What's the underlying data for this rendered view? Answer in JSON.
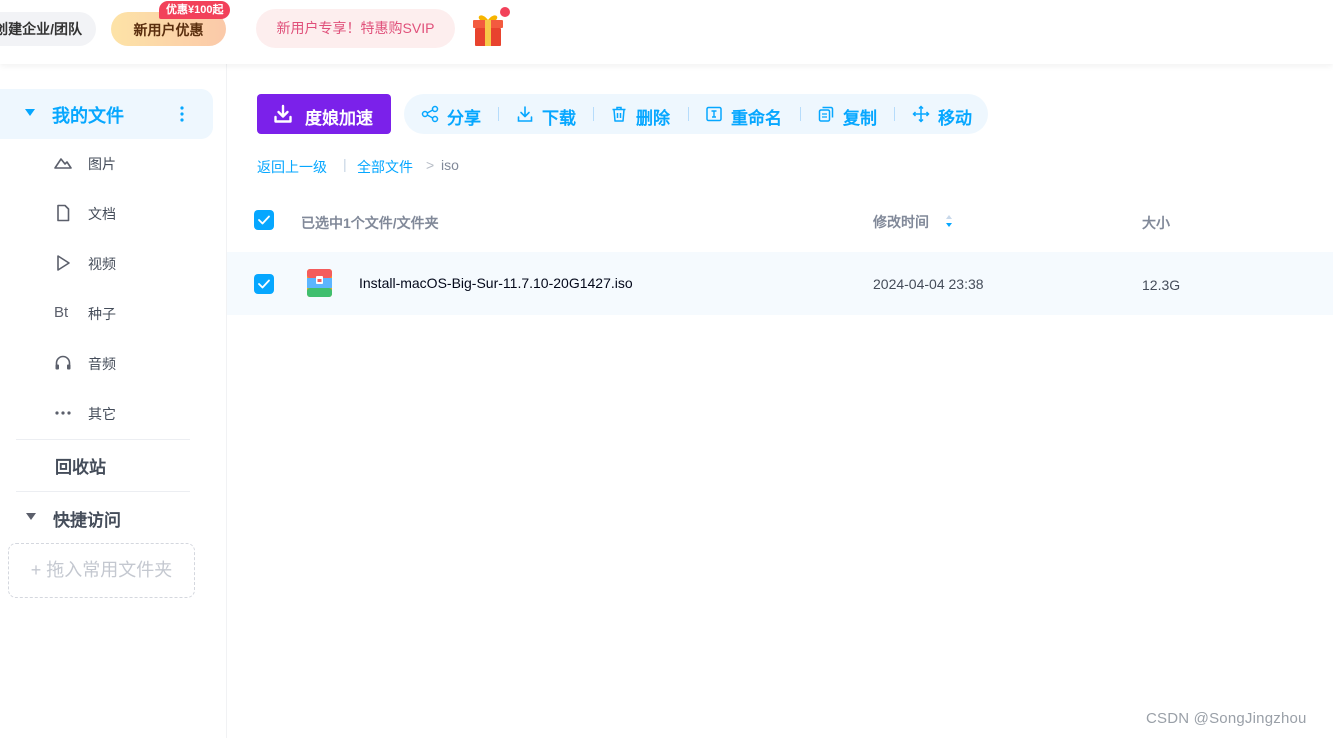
{
  "topbar": {
    "team_label": "创建企业/团队",
    "newuser_label": "新用户优惠",
    "newuser_badge": "优惠¥100起",
    "svip_promo": "新用户专享！特惠购SVIP",
    "gift_icon": "gift-icon"
  },
  "sidebar": {
    "my_files": "我的文件",
    "categories": [
      {
        "label": "图片",
        "icon": "image-icon"
      },
      {
        "label": "文档",
        "icon": "document-icon"
      },
      {
        "label": "视频",
        "icon": "video-icon"
      },
      {
        "label": "种子",
        "icon": "bt",
        "icon_text": "Bt"
      },
      {
        "label": "音频",
        "icon": "headphones-icon"
      },
      {
        "label": "其它",
        "icon": "more-icon"
      }
    ],
    "recycle": "回收站",
    "quick_access": "快捷访问",
    "dropzone": "+ 拖入常用文件夹"
  },
  "toolbar": {
    "speed": "度娘加速",
    "share": "分享",
    "download": "下载",
    "delete": "删除",
    "rename": "重命名",
    "copy": "复制",
    "move": "移动"
  },
  "breadcrumb": {
    "back": "返回上一级",
    "sep": "|",
    "all": "全部文件",
    "arrow": ">",
    "current": "iso"
  },
  "table": {
    "selection_summary": "已选中1个文件/文件夹",
    "col_modified": "修改时间",
    "col_size": "大小",
    "rows": [
      {
        "name": "Install-macOS-Big-Sur-11.7.10-20G1427.iso",
        "modified": "2024-04-04 23:38",
        "size": "12.3G",
        "checked": true
      }
    ]
  },
  "colors": {
    "accent": "#06a7ff",
    "speed_button": "#7b21ea",
    "badge_red": "#f2415a"
  },
  "watermark": "CSDN @SongJingzhou"
}
